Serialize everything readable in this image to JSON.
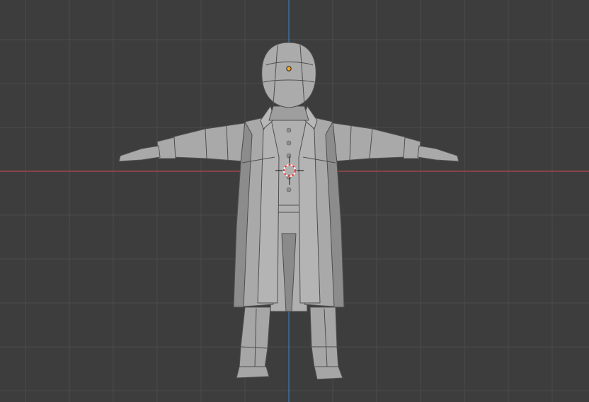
{
  "viewport": {
    "view": "front-orthographic",
    "background_color": "#3d3d3d",
    "grid_color": "#4a4a4a",
    "x_axis_color": "#b34a52",
    "z_axis_color": "#3d7bb3",
    "object_origin_color": "#f5a623",
    "cursor_color": "#ff2f2f"
  },
  "model": {
    "icon": "lowpoly-character-in-coat",
    "fill_color": "#a9a9a9",
    "shadow_color": "#868686",
    "edge_color": "#4e4e4e"
  }
}
